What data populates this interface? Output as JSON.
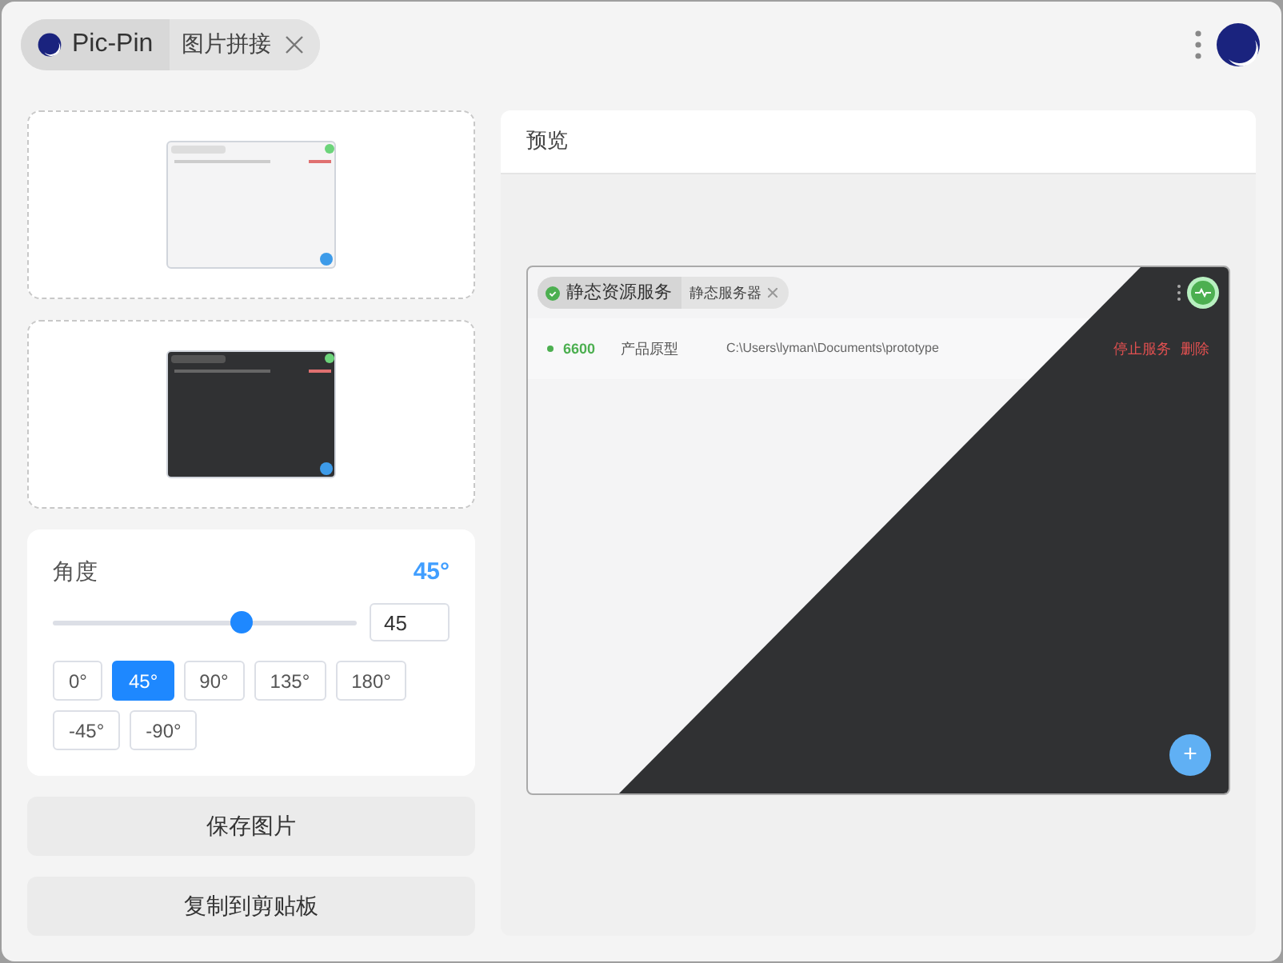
{
  "app": {
    "name": "Pic-Pin"
  },
  "tabs": [
    {
      "label": "图片拼接",
      "selected": true
    }
  ],
  "sources": [
    {
      "kind": "light"
    },
    {
      "kind": "dark"
    }
  ],
  "angle": {
    "label": "角度",
    "reading": "45°",
    "level": 0.62,
    "value": "45",
    "presets": [
      {
        "label": "0°",
        "selected": false
      },
      {
        "label": "45°",
        "selected": true
      },
      {
        "label": "90°",
        "selected": false
      },
      {
        "label": "135°",
        "selected": false
      },
      {
        "label": "180°",
        "selected": false
      },
      {
        "label": "-45°",
        "selected": false
      },
      {
        "label": "-90°",
        "selected": false
      }
    ]
  },
  "actions": [
    "保存图片",
    "复制到剪贴板"
  ],
  "preview": {
    "title": "预览",
    "image": {
      "tabs": [
        "静态资源服务",
        "静态服务器"
      ],
      "row": {
        "port": "6600",
        "name": "产品原型",
        "path": "C:\\Users\\lyman\\Documents\\prototype",
        "stop": "停止服务",
        "delete": "删除"
      },
      "fab": "+"
    }
  }
}
